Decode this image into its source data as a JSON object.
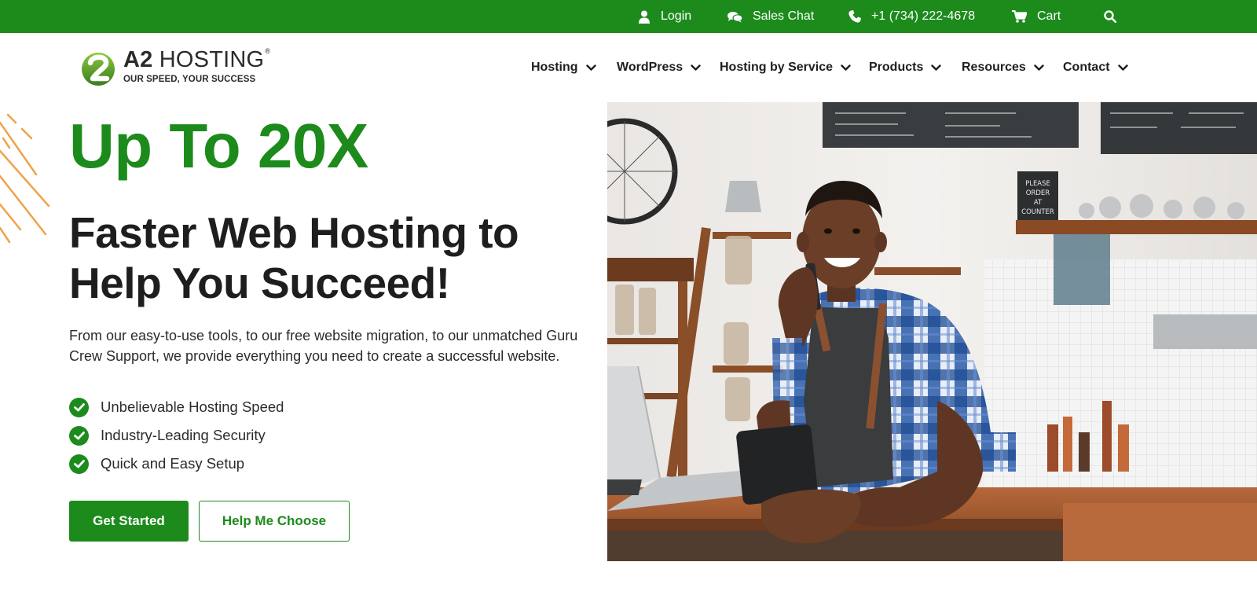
{
  "topbar": {
    "bg_color": "#1c8b1c",
    "items": [
      {
        "label": "Login",
        "icon": "user-icon"
      },
      {
        "label": "Sales Chat",
        "icon": "chat-icon"
      },
      {
        "label": "+1 (734) 222-4678",
        "icon": "phone-icon"
      },
      {
        "label": "Cart",
        "icon": "cart-icon"
      }
    ],
    "search_icon": "search-icon"
  },
  "logo": {
    "brand_bold": "A2",
    "brand_rest": "HOSTING",
    "registered": "®",
    "tagline": "OUR SPEED, YOUR SUCCESS",
    "mark_text": "2"
  },
  "nav": {
    "items": [
      {
        "label": "Hosting"
      },
      {
        "label": "WordPress"
      },
      {
        "label": "Hosting by Service"
      },
      {
        "label": "Products"
      },
      {
        "label": "Resources"
      },
      {
        "label": "Contact"
      }
    ]
  },
  "hero": {
    "headline": "Up To 20X",
    "subheadline": "Faster Web Hosting to Help You Succeed!",
    "description": "From our easy-to-use tools, to our free website migration, to our unmatched Guru Crew Support, we provide everything you need to create a successful website.",
    "features": [
      "Unbelievable Hosting Speed",
      "Industry-Leading Security",
      "Quick and Easy Setup"
    ],
    "primary_button": "Get Started",
    "secondary_button": "Help Me Choose",
    "accent_color": "#1c8b1c",
    "stripe_color": "#f0a24a"
  },
  "photo": {
    "chalkboard_text": "PLEASE ORDER AT COUNTER"
  }
}
